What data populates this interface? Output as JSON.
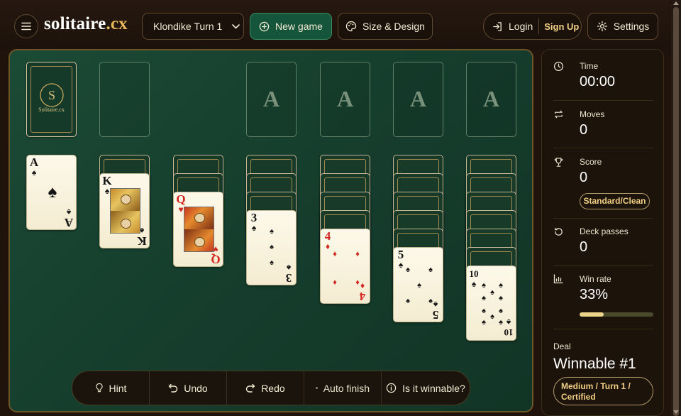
{
  "header": {
    "logo_main": "solitaire",
    "logo_tld": ".cx",
    "game_select": "Klondike Turn 1",
    "new_game_label": "New game",
    "design_label": "Size & Design",
    "login_label": "Login",
    "signup_label": "Sign Up",
    "settings_label": "Settings"
  },
  "board": {
    "stock_back_text": "Solitaire.cx",
    "foundation_letter": "A",
    "tableau": [
      {
        "hidden": 0,
        "rank": "A",
        "suit": "♠",
        "color": "black"
      },
      {
        "hidden": 1,
        "rank": "K",
        "suit": "♠",
        "color": "black"
      },
      {
        "hidden": 2,
        "rank": "Q",
        "suit": "♥",
        "color": "red"
      },
      {
        "hidden": 3,
        "rank": "3",
        "suit": "♠",
        "color": "black"
      },
      {
        "hidden": 4,
        "rank": "4",
        "suit": "♦",
        "color": "red"
      },
      {
        "hidden": 5,
        "rank": "5",
        "suit": "♠",
        "color": "black"
      },
      {
        "hidden": 6,
        "rank": "10",
        "suit": "♠",
        "color": "black"
      }
    ]
  },
  "toolbar": {
    "hint": "Hint",
    "undo": "Undo",
    "redo": "Redo",
    "auto_finish": "Auto finish",
    "winnable": "Is it winnable?"
  },
  "stats": {
    "time_label": "Time",
    "time_value": "00:00",
    "moves_label": "Moves",
    "moves_value": "0",
    "score_label": "Score",
    "score_value": "0",
    "score_mode": "Standard/Clean",
    "passes_label": "Deck passes",
    "passes_value": "0",
    "winrate_label": "Win rate",
    "winrate_value": "33%",
    "winrate_fraction": 0.33,
    "deal_label": "Deal",
    "deal_value": "Winnable #1",
    "deal_badge": "Medium / Turn 1 / Certified"
  },
  "colors": {
    "felt": "#1b4a35",
    "accent_gold": "#e9b65a",
    "new_game_bg": "#14553c",
    "red_suit": "#d2261f"
  }
}
